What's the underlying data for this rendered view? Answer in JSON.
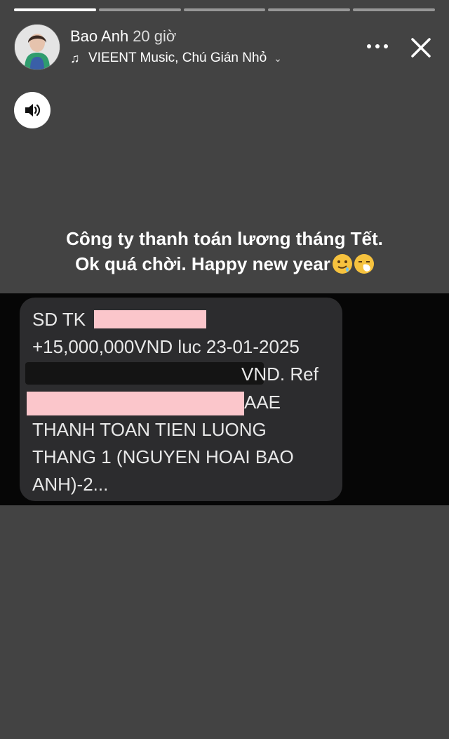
{
  "story": {
    "progress_segments": [
      1,
      0,
      0,
      0,
      0
    ],
    "user_name": "Bao Anh",
    "time_ago": "20 giờ",
    "music_text": "VIEENT Music, Chú Gián Nhỏ",
    "caption_line1": "Công ty thanh toán lương tháng Tết.",
    "caption_line2": "Ok quá chời. Happy new year"
  },
  "icons": {
    "music": "music-note-icon",
    "chevron": "chevron-down-icon",
    "more": "more-horizontal-icon",
    "close": "close-icon",
    "sound": "speaker-icon",
    "emoji1": "drooling-face-emoji",
    "emoji2": "sneezing-face-emoji"
  },
  "sms": {
    "line1": "SD TK",
    "line2": "+15,000,000VND luc 23-01-2025",
    "line3": "VND. Ref",
    "line4": "AAE",
    "line5": "THANH TOAN TIEN LUONG",
    "line6": "THANG 1 (NGUYEN HOAI BAO",
    "line7": "ANH)-2..."
  },
  "colors": {
    "background": "#434343",
    "redaction": "#fbc6cb",
    "bubble": "#2c2c2e"
  }
}
